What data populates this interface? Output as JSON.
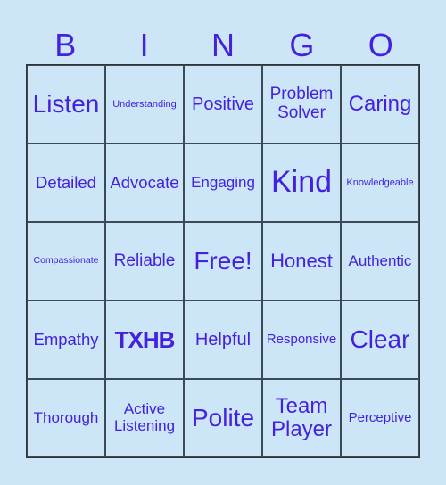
{
  "header": {
    "letters": [
      "B",
      "I",
      "N",
      "G",
      "O"
    ]
  },
  "card": {
    "accent_color": "#4422dd",
    "background_color": "#cce6f8",
    "cells": [
      [
        "Listen",
        "Understanding",
        "Positive",
        "Problem Solver",
        "Caring"
      ],
      [
        "Detailed",
        "Advocate",
        "Engaging",
        "Kind",
        "Knowledgeable"
      ],
      [
        "Compassionate",
        "Reliable",
        "Free!",
        "Honest",
        "Authentic"
      ],
      [
        "Empathy",
        "TXHB",
        "Helpful",
        "Responsive",
        "Clear"
      ],
      [
        "Thorough",
        "Active Listening",
        "Polite",
        "Team Player",
        "Perceptive"
      ]
    ]
  }
}
